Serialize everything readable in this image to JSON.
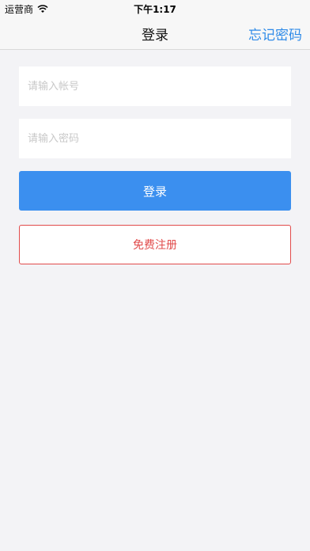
{
  "status_bar": {
    "carrier": "运营商",
    "time": "下午1:17",
    "wifi_icon": "wifi-icon"
  },
  "nav": {
    "title": "登录",
    "right_action": "忘记密码"
  },
  "form": {
    "account_placeholder": "请输入帐号",
    "account_value": "",
    "password_placeholder": "请输入密码",
    "password_value": ""
  },
  "buttons": {
    "login_label": "登录",
    "register_label": "免费注册"
  },
  "colors": {
    "accent_blue": "#3b8fef",
    "link_blue": "#2f8be8",
    "register_red": "#e14b4b",
    "background": "#f3f3f6"
  }
}
